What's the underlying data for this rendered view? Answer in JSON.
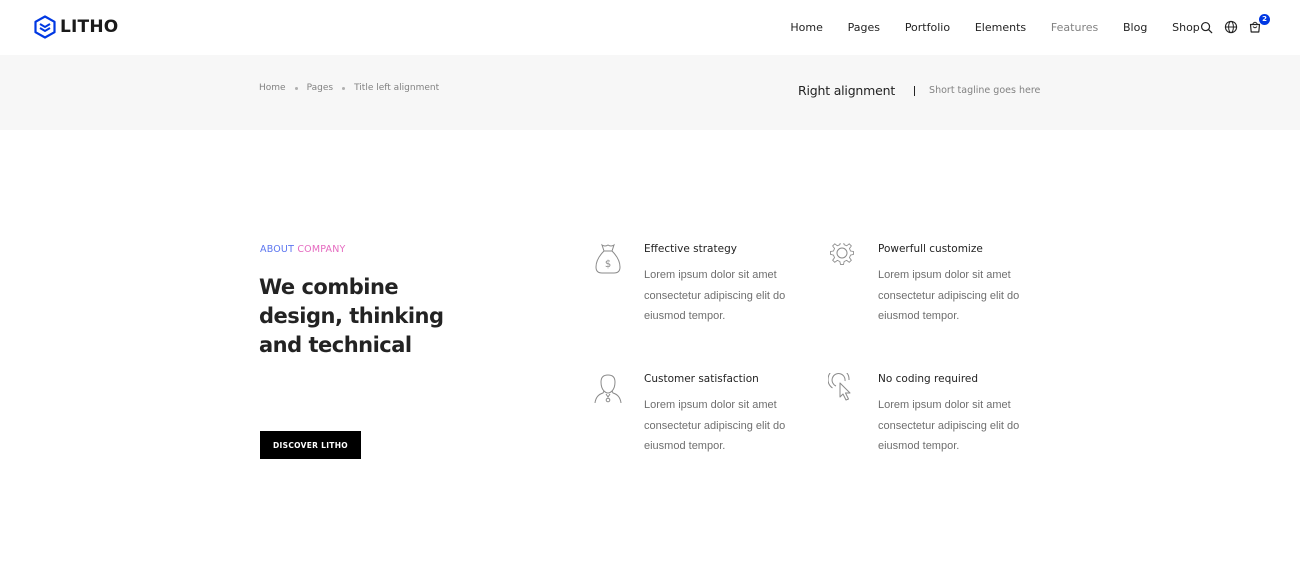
{
  "brand": {
    "name": "LITHO",
    "accent": "#0038e3"
  },
  "nav": {
    "items": [
      {
        "label": "Home"
      },
      {
        "label": "Pages"
      },
      {
        "label": "Portfolio"
      },
      {
        "label": "Elements"
      },
      {
        "label": "Features"
      },
      {
        "label": "Blog"
      },
      {
        "label": "Shop"
      }
    ],
    "icons": [
      "search-icon",
      "globe-icon",
      "cart-icon"
    ],
    "cart_count": "2"
  },
  "title_bar": {
    "breadcrumb": [
      "Home",
      "Pages",
      "Title left alignment"
    ],
    "title": "Right alignment",
    "tagline": "Short tagline goes here"
  },
  "main": {
    "eyebrow_part1": "ABOUT",
    "eyebrow_part2": "COMPANY",
    "headline": "We combine design, thinking and technical",
    "button_label": "DISCOVER LITHO",
    "features": [
      {
        "icon": "money-bag-icon",
        "title": "Effective strategy",
        "description": "Lorem ipsum dolor sit amet consectetur adipiscing elit do eiusmod tempor."
      },
      {
        "icon": "gear-icon",
        "title": "Powerfull customize",
        "description": "Lorem ipsum dolor sit amet consectetur adipiscing elit do eiusmod tempor."
      },
      {
        "icon": "user-icon",
        "title": "Customer satisfaction",
        "description": "Lorem ipsum dolor sit amet consectetur adipiscing elit do eiusmod tempor."
      },
      {
        "icon": "cursor-click-icon",
        "title": "No coding required",
        "description": "Lorem ipsum dolor sit amet consectetur adipiscing elit do eiusmod tempor."
      }
    ]
  }
}
